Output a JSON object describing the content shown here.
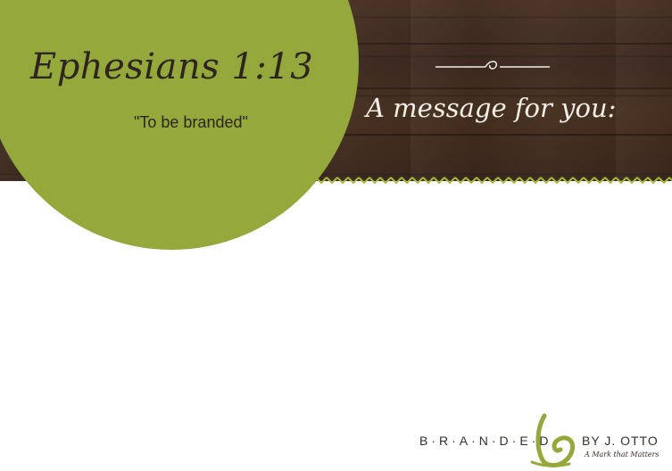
{
  "header": {
    "title": "Ephesians 1:13",
    "subtitle": "\"To be branded\""
  },
  "message": {
    "text": "A message for you:"
  },
  "logo": {
    "left_text": "B·R·A·N·D·E·D",
    "right_text": "BY J. OTTO",
    "tagline": "A Mark that Matters",
    "icon": "script-b-logo-icon"
  },
  "colors": {
    "accent_green": "#94a83b",
    "wood_brown": "#3e2a20",
    "text_dark": "#2f2520",
    "message_text": "#f2efe9"
  }
}
